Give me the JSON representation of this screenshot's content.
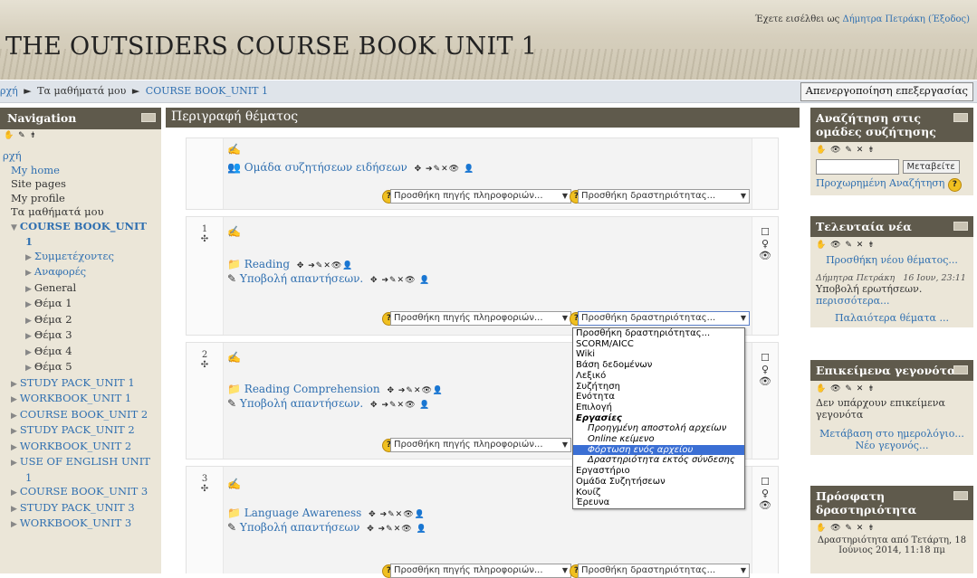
{
  "header": {
    "site_title": "THE OUTSIDERS COURSE BOOK UNIT 1",
    "login_prefix": "Έχετε εισέλθει ως",
    "user_name": "Δήμητρα Πετράκη",
    "logout": "(Έξοδος)"
  },
  "navbar": {
    "crumb_home": "ρχή",
    "crumb_sep": "►",
    "crumb_courses": "Τα μαθήματά μου",
    "crumb_course": "COURSE BOOK_UNIT 1",
    "edit_button": "Απενεργοποίηση επεξεργασίας"
  },
  "nav_block": {
    "title": "Navigation",
    "items": {
      "home": "ρχή",
      "my_home": "My home",
      "site_pages": "Site pages",
      "my_profile": "My profile",
      "my_courses": "Τα μαθήματά μου",
      "course1_a": "COURSE BOOK_UNIT",
      "course1_b": "1",
      "participants": "Συμμετέχοντες",
      "reports": "Αναφορές",
      "general": "General",
      "topic1": "Θέμα 1",
      "topic2": "Θέμα 2",
      "topic3": "Θέμα 3",
      "topic4": "Θέμα 4",
      "topic5": "Θέμα 5",
      "c2": "STUDY PACK_UNIT 1",
      "c3": "WORKBOOK_UNIT 1",
      "c4": "COURSE BOOK_UNIT 2",
      "c5": "STUDY PACK_UNIT 2",
      "c6": "WORKBOOK_UNIT 2",
      "c7a": "USE OF ENGLISH UNIT",
      "c7b": "1",
      "c8": "COURSE BOOK_UNIT 3",
      "c9": "STUDY PACK_UNIT 3",
      "c10": "WORKBOOK_UNIT 3"
    }
  },
  "main": {
    "heading": "Περιγραφή θέματος",
    "add_resource": "Προσθήκη πηγής πληροφοριών...",
    "add_activity": "Προσθήκη δραστηριότητας...",
    "section0": {
      "forum": "Ομάδα συζητήσεων ειδήσεων"
    },
    "section1": {
      "num": "1",
      "item1": "Reading",
      "item2": "Υποβολή απαντήσεων."
    },
    "section2": {
      "num": "2",
      "item1": "Reading Comprehension",
      "item2": "Υποβολή απαντήσεων."
    },
    "section3": {
      "num": "3",
      "item1": "Language Awareness",
      "item2": "Υποβολή απαντήσεων"
    }
  },
  "dropdown_options": {
    "o0": "Προσθήκη δραστηριότητας...",
    "o1": "SCORM/AICC",
    "o2": "Wiki",
    "o3": "Βάση δεδομένων",
    "o4": "Λεξικό",
    "o5": "Συζήτηση",
    "o6": "Ενότητα",
    "o7": "Επιλογή",
    "o8": "Εργασίες",
    "o9": "Προηγμένη αποστολή αρχείων",
    "o10": "Online κείμενο",
    "o11": "Φόρτωση ενός αρχείου",
    "o12": "Δραστηριότητα εκτός σύνδεσης",
    "o13": "Εργαστήριο",
    "o14": "Ομάδα Συζητήσεων",
    "o15": "Κουίζ",
    "o16": "Έρευνα"
  },
  "right_blocks": {
    "search": {
      "title": "Αναζήτηση στις ομάδες συζήτησης",
      "go": "Μεταβείτε",
      "advanced": "Προχωρημένη Αναζήτηση"
    },
    "news": {
      "title": "Τελευταία νέα",
      "add": "Προσθήκη νέου θέματος...",
      "author": "Δήμητρα Πετράκη",
      "date": "16 Ιουν, 23:11",
      "subject": "Υποβολή ερωτήσεων.",
      "more": "περισσότερα...",
      "older": "Παλαιότερα θέματα ..."
    },
    "events": {
      "title": "Επικείμενα γεγονότα",
      "none": "Δεν υπάρχουν επικείμενα γεγονότα",
      "calendar": "Μετάβαση στο ημερολόγιο...",
      "new_event": "Νέο γεγονός..."
    },
    "recent": {
      "title": "Πρόσφατη δραστηριότητα",
      "since": "Δραστηριότητα από Τετάρτη, 18 Ιούνιος 2014, 11:18 πμ"
    }
  }
}
